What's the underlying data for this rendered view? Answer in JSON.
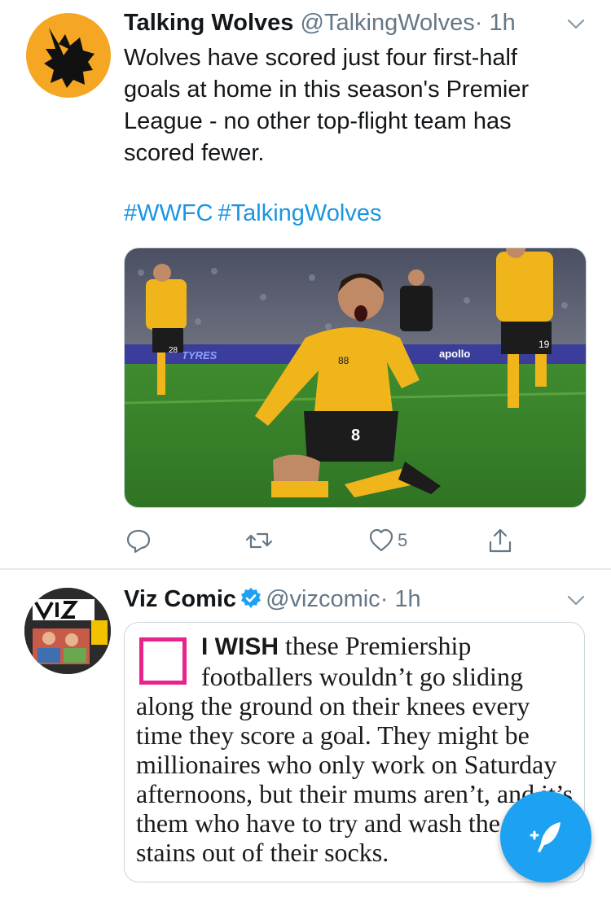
{
  "tweet1": {
    "name": "Talking Wolves",
    "handle": "@TalkingWolves",
    "dot": "·",
    "time": "1h",
    "text": "Wolves have scored just four first-half goals at home in this season's Premier League - no other top-flight team has scored fewer.",
    "hashtags": [
      "#WWFC",
      "#TalkingWolves"
    ],
    "likes": "5",
    "avatar_icon": "wolf-head-icon",
    "media_signs": {
      "sponsor_left": "TYRES",
      "sponsor_right": "apollo",
      "player_number": "8",
      "shorts_number": "88",
      "bg_player_number": "19",
      "bg_player2_number": "28"
    }
  },
  "tweet2": {
    "name": "Viz Comic",
    "handle": "@vizcomic",
    "dot": "·",
    "time": "1h",
    "verified": true,
    "avatar_icon": "viz-comic-cover-icon",
    "clipping": {
      "lead": "I WISH",
      "body": "these Premiership footballers wouldn’t go sliding along the ground on their knees every time they score a goal. They might be millionaires who only work on Saturday afternoons, but their mums aren’t, and it’s them who have to try and wash the grass stains out of their socks."
    }
  },
  "colors": {
    "link": "#1b95e0",
    "fab": "#1da1f2",
    "muted": "#657786",
    "pink": "#e8248c"
  }
}
